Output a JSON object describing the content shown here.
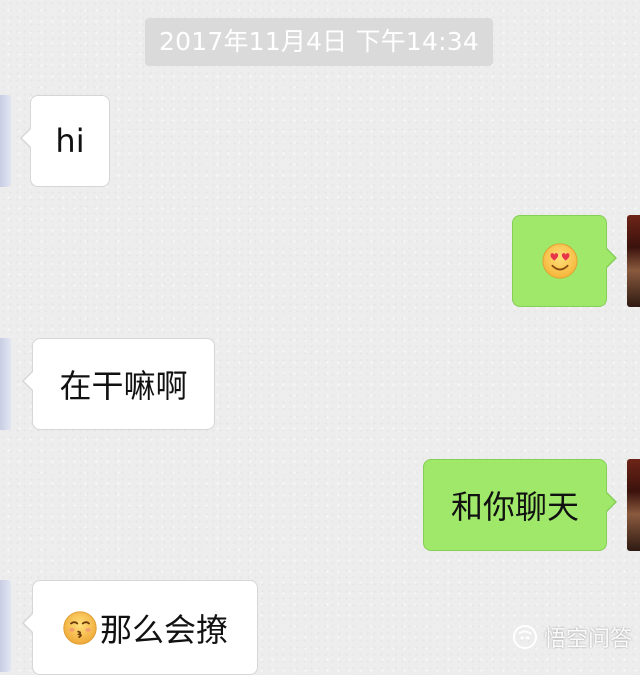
{
  "timestamp": "2017年11月4日 下午14:34",
  "messages": [
    {
      "side": "in",
      "text": "hi"
    },
    {
      "side": "out",
      "text": "",
      "emoji": "heart-eyes-face-icon"
    },
    {
      "side": "in",
      "text": "在干嘛啊"
    },
    {
      "side": "out",
      "text": "和你聊天"
    },
    {
      "side": "in",
      "text": "那么会撩",
      "emoji": "kissing-face-icon"
    }
  ],
  "watermark": {
    "text": "悟空问答",
    "icon": "wukong-logo-icon"
  },
  "colors": {
    "background": "#ededed",
    "incoming_bubble": "#ffffff",
    "outgoing_bubble": "#9fe86a",
    "timestamp_bg": "#dadada"
  }
}
